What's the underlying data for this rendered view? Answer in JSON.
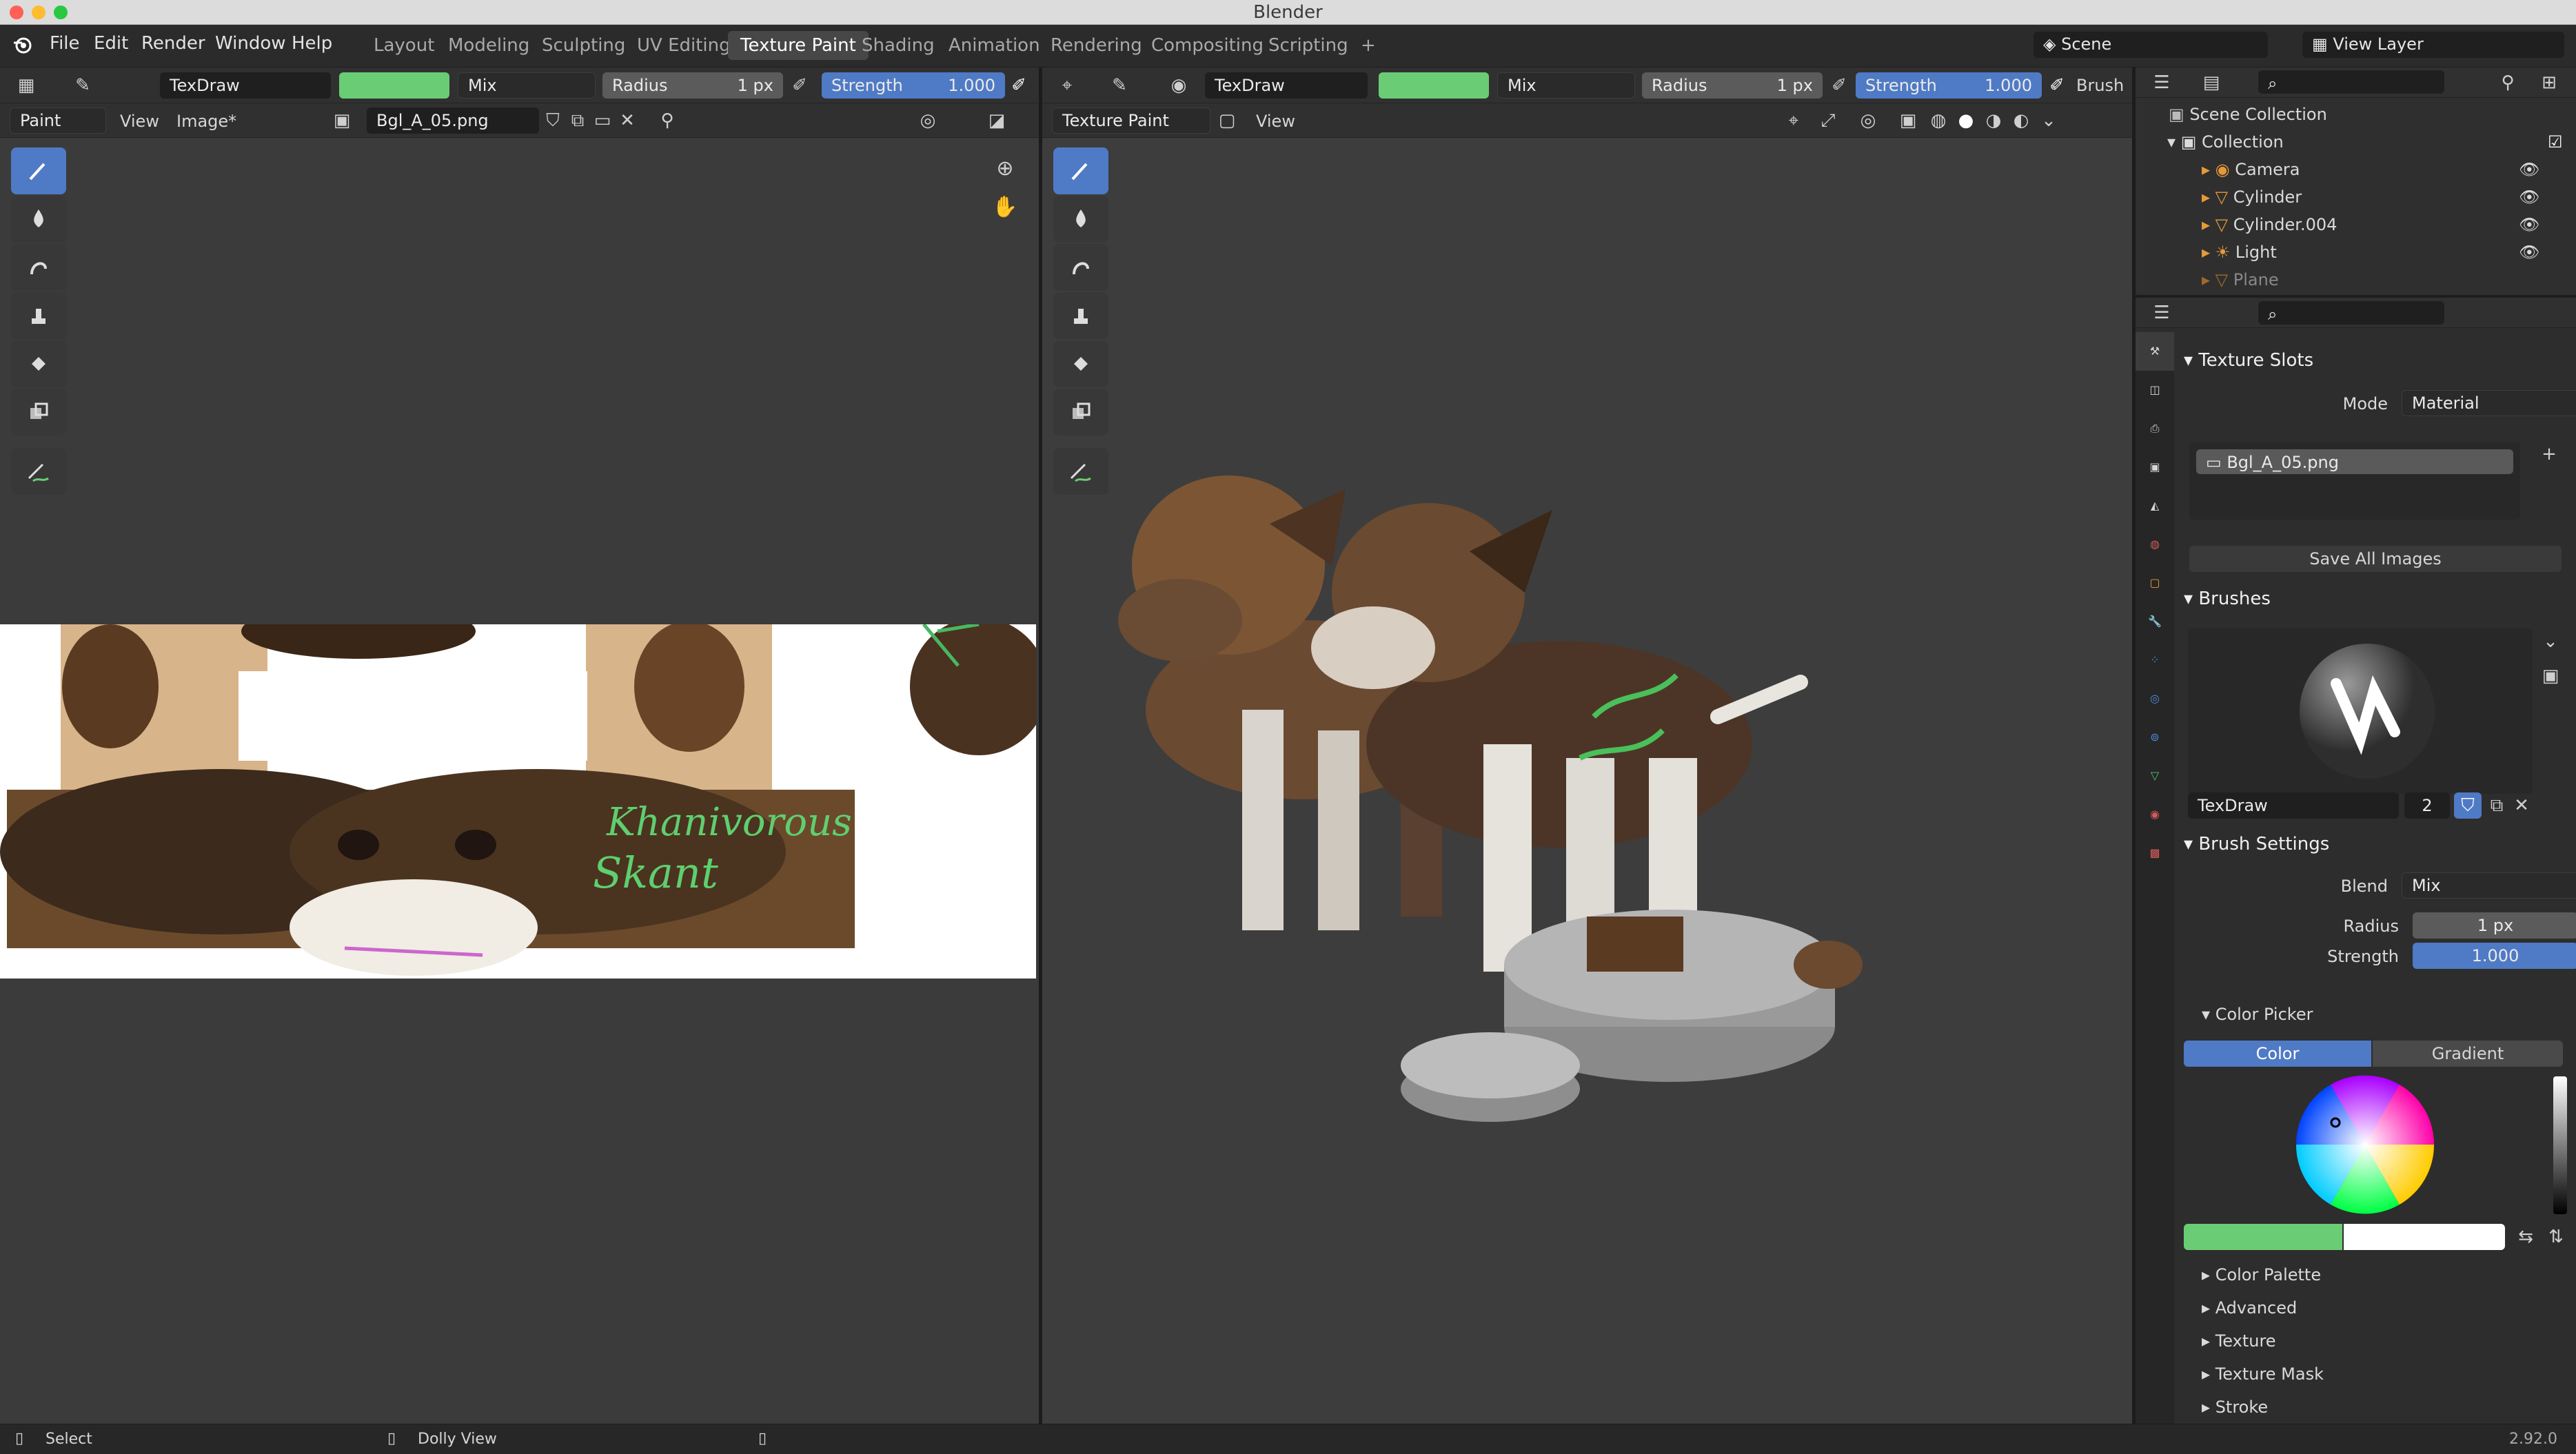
{
  "window": {
    "title": "Blender"
  },
  "menu": [
    "File",
    "Edit",
    "Render",
    "Window",
    "Help"
  ],
  "workspaces": [
    "Layout",
    "Modeling",
    "Sculpting",
    "UV Editing",
    "Texture Paint",
    "Shading",
    "Animation",
    "Rendering",
    "Compositing",
    "Scripting",
    "+"
  ],
  "active_workspace": "Texture Paint",
  "scene": {
    "name": "Scene",
    "view_layer": "View Layer"
  },
  "left_header": {
    "brush_name": "TexDraw",
    "blend": "Mix",
    "radius_label": "Radius",
    "radius_value": "1 px",
    "strength_label": "Strength",
    "strength_value": "1.000",
    "mode": "Paint",
    "view": "View",
    "image_menu": "Image*",
    "image_name": "Bgl_A_05.png"
  },
  "right_header": {
    "brush_name": "TexDraw",
    "blend": "Mix",
    "radius_label": "Radius",
    "radius_value": "1 px",
    "strength_label": "Strength",
    "strength_value": "1.000",
    "brush_label": "Brush",
    "mode": "Texture Paint",
    "view": "View"
  },
  "texture_text": [
    "Khanivorous",
    "Skant"
  ],
  "outliner": {
    "scene_collection": "Scene Collection",
    "collection": "Collection",
    "items": [
      "Camera",
      "Cylinder",
      "Cylinder.004",
      "Light",
      "Plane"
    ]
  },
  "properties": {
    "texture_slots": {
      "title": "Texture Slots",
      "mode_label": "Mode",
      "mode_value": "Material",
      "slot": "Bgl_A_05.png",
      "save_all": "Save All Images"
    },
    "brushes": {
      "title": "Brushes",
      "brush_name": "TexDraw",
      "users": "2"
    },
    "brush_settings": {
      "title": "Brush Settings",
      "blend_label": "Blend",
      "blend_value": "Mix",
      "radius_label": "Radius",
      "radius_value": "1 px",
      "strength_label": "Strength",
      "strength_value": "1.000",
      "color_picker": "Color Picker",
      "color_tab": "Color",
      "gradient_tab": "Gradient",
      "collapsed": [
        "Color Palette",
        "Advanced",
        "Texture",
        "Texture Mask",
        "Stroke"
      ]
    }
  },
  "status": {
    "left": "Select",
    "middle": "Dolly View",
    "version": "2.92.0"
  },
  "colors": {
    "accent": "#4f7ac5",
    "paint_green": "#6acc75",
    "panel": "#303030"
  }
}
